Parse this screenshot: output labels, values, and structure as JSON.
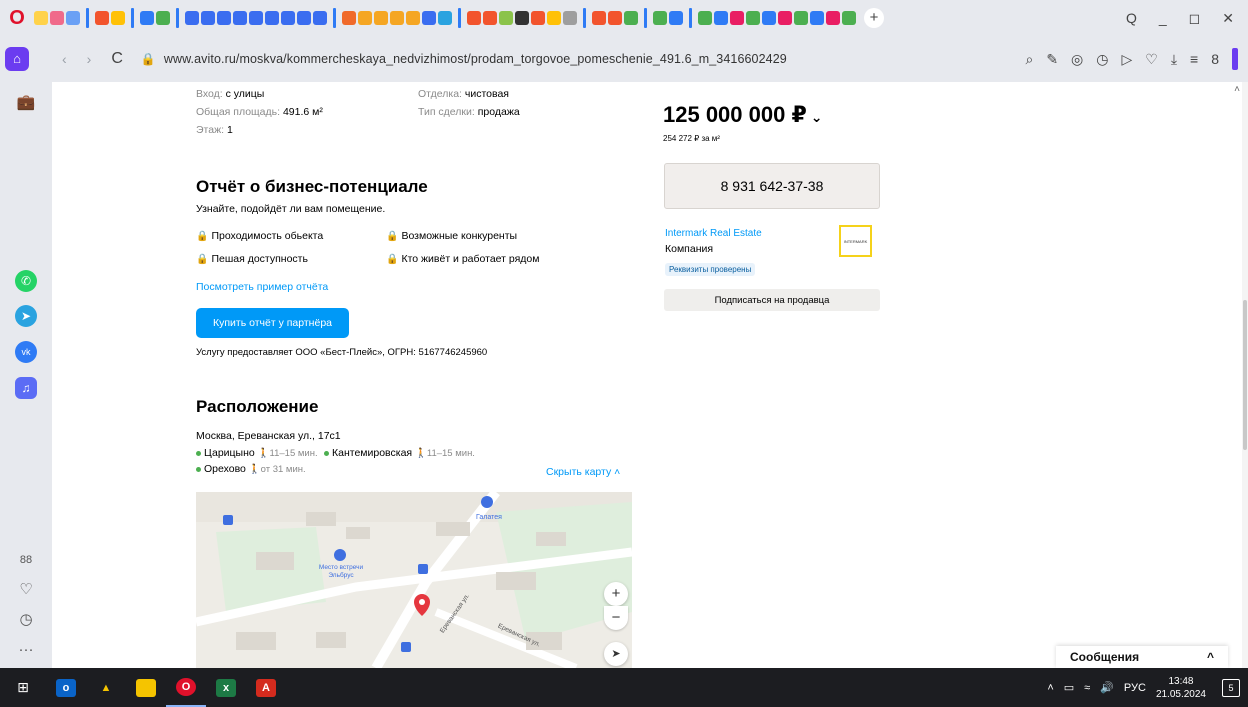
{
  "browser": {
    "url": "www.avito.ru/moskva/kommercheskaya_nedvizhimost/prodam_torgovoe_pomeschenie_491.6_m_3416602429",
    "logo_glyph": "O",
    "home_glyph": "⌂",
    "back_glyph": "‹",
    "forward_glyph": "›",
    "reload_glyph": "C",
    "lock_glyph": "🔒",
    "new_tab_glyph": "+",
    "window_controls": [
      "Q",
      "_",
      "◻",
      "✕"
    ],
    "address_actions": [
      "⌕",
      "✎",
      "◎",
      "◷",
      "▷",
      "♡",
      "⤓",
      "≡",
      "8"
    ]
  },
  "sidebar": {
    "top_icon": "⌂",
    "briefcase_icon": "💼",
    "apps": [
      {
        "name": "whatsapp",
        "glyph": "✆",
        "color": "#25d366"
      },
      {
        "name": "telegram",
        "glyph": "➤",
        "color": "#2aa3e0"
      },
      {
        "name": "vk",
        "glyph": "vk",
        "color": "#2f7bf5"
      },
      {
        "name": "music",
        "glyph": "♫",
        "color": "#5b6cf5"
      }
    ],
    "bottom_icons": [
      "88",
      "♡",
      "◷",
      "···"
    ]
  },
  "listing": {
    "params": [
      {
        "label": "Вход:",
        "value": "с улицы"
      },
      {
        "label": "Общая площадь:",
        "value": "491.6 м²"
      },
      {
        "label": "Этаж:",
        "value": "1"
      },
      {
        "label": "Отделка:",
        "value": "чистовая"
      },
      {
        "label": "Тип сделки:",
        "value": "продажа"
      }
    ],
    "report": {
      "title": "Отчёт о бизнес-потенциале",
      "subtitle": "Узнайте, подойдёт ли вам помещение.",
      "features": [
        "Проходимость обьекта",
        "Возможные конкуренты",
        "Пешая доступность",
        "Кто живёт и работает рядом"
      ],
      "example_link": "Посмотреть пример отчёта",
      "buy_button": "Купить отчёт у партнёра",
      "provider_note": "Услугу предоставляет ООО «Бест-Плейс», ОГРН: 5167746245960"
    },
    "location": {
      "title": "Расположение",
      "address": "Москва, Ереванская ул., 17с1",
      "metro": [
        {
          "station": "Царицыно",
          "walk": "11–15 мин."
        },
        {
          "station": "Кантемировская",
          "walk": "11–15 мин."
        },
        {
          "station": "Орехово",
          "walk": "от 31 мин."
        }
      ],
      "hide_map": "Скрыть карту",
      "map_labels": [
        "Галатея",
        "Место встречи Эльбрус",
        "Ереванская ул.",
        "Ереванская ул."
      ]
    },
    "price": {
      "main": "125 000 000 ₽",
      "per_m2": "254 272 ₽ за м²",
      "phone": "8 931 642-37-38"
    },
    "seller": {
      "name": "Intermark Real Estate",
      "type": "Компания",
      "badge": "Реквизиты проверены",
      "logo_text": "INTERMARK",
      "subscribe": "Подписаться на продавца"
    }
  },
  "messages": {
    "title": "Сообщения",
    "toggle_glyph": "^"
  },
  "taskbar": {
    "lang": "РУС",
    "time": "13:48",
    "date": "21.05.2024",
    "notifications": "5"
  }
}
